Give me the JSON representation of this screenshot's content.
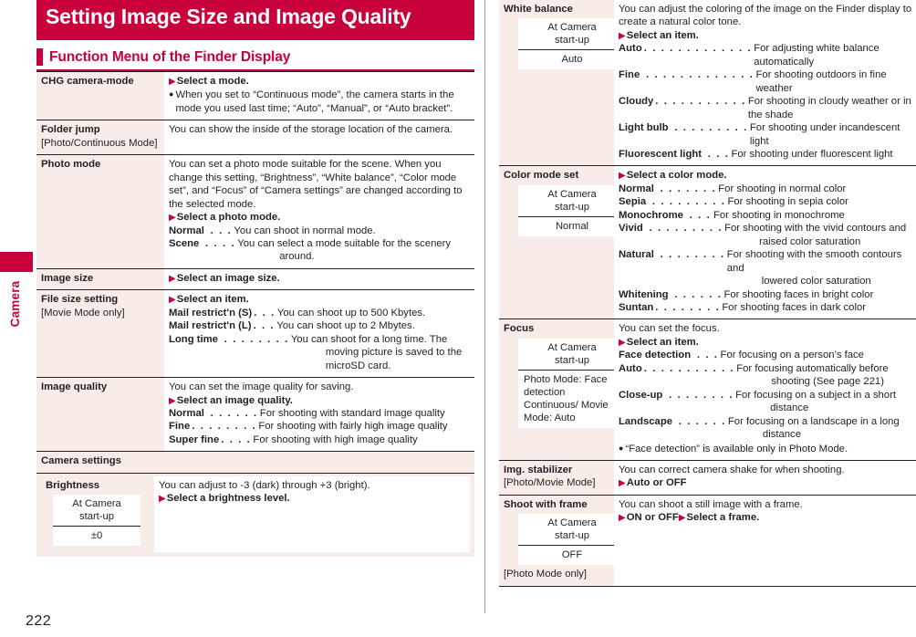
{
  "document": {
    "title": "Setting Image Size and Image Quality",
    "subhead": "Function Menu of the Finder Display",
    "page_number": "222",
    "edge_tab_label": "Camera",
    "accent_color": "#c8003c",
    "label_bg_color": "#f8ece8"
  },
  "start_up_box": {
    "header": "At Camera start-up",
    "header_line1": "At Camera",
    "header_line2": "start-up"
  },
  "left_column": {
    "rows": [
      {
        "label": "CHG camera-mode",
        "sublabel": "",
        "step": "Select a mode.",
        "bullets": [
          "When you set to “Continuous mode”, the camera starts in the mode you used last time; “Auto”, “Manual”, or “Auto bracket”."
        ],
        "intro": "",
        "defs": []
      },
      {
        "label": "Folder jump",
        "sublabel": "[Photo/Continuous Mode]",
        "step": "",
        "bullets": [],
        "intro": "You can show the inside of the storage location of the camera.",
        "defs": []
      },
      {
        "label": "Photo mode",
        "sublabel": "",
        "step": "Select a photo mode.",
        "bullets": [],
        "intro": "You can set a photo mode suitable for the scene. When you change this setting, “Brightness”, “White balance”, “Color mode set”, and “Focus” of “Camera settings” are changed according to the selected mode.",
        "defs": [
          {
            "term": "Normal",
            "def": "You can shoot in normal mode."
          },
          {
            "term": "Scene",
            "def": "You can select a mode suitable for the scenery",
            "cont": "around."
          }
        ]
      },
      {
        "label": "Image size",
        "sublabel": "",
        "step": "Select an image size.",
        "bullets": [],
        "intro": "",
        "defs": []
      },
      {
        "label": "File size setting",
        "sublabel": "[Movie Mode only]",
        "step": "Select an item.",
        "bullets": [],
        "intro": "",
        "defs": [
          {
            "term": "Mail restrict'n (S)",
            "def": "You can shoot up to 500 Kbytes."
          },
          {
            "term": "Mail restrict'n (L)",
            "def": "You can shoot up to 2 Mbytes."
          },
          {
            "term": "Long time",
            "def": "You can shoot for a long time. The",
            "cont": "moving picture is saved to the microSD card."
          }
        ]
      },
      {
        "label": "Image quality",
        "sublabel": "",
        "step": "Select an image quality.",
        "bullets": [],
        "intro": "You can set the image quality for saving.",
        "defs": [
          {
            "term": "Normal",
            "def": "For shooting with standard image quality"
          },
          {
            "term": "Fine",
            "def": "For shooting with fairly high image quality"
          },
          {
            "term": "Super fine",
            "def": "For shooting with high image quality"
          }
        ]
      }
    ],
    "section": {
      "title": "Camera settings",
      "rows": [
        {
          "label": "Brightness",
          "intro": "You can adjust to -3 (dark) through +3 (bright).",
          "step": "Select a brightness level.",
          "startup_value": "±0"
        }
      ]
    }
  },
  "right_column": {
    "rows": [
      {
        "label": "White balance",
        "sublabel": "",
        "startup_value": "Auto",
        "startup_value_multiline": "",
        "intro": "You can adjust the coloring of the image on the Finder display to create a natural color tone.",
        "step": "Select an item.",
        "defs": [
          {
            "term": "Auto",
            "def": "For adjusting white balance",
            "cont": "automatically"
          },
          {
            "term": "Fine",
            "def": "For shooting outdoors in fine weather"
          },
          {
            "term": "Cloudy",
            "def": "For shooting in cloudy weather or in",
            "cont": "the shade"
          },
          {
            "term": "Light bulb",
            "def": "For shooting under incandescent light"
          },
          {
            "term": "Fluorescent light",
            "def": "For shooting under fluorescent light"
          }
        ],
        "bullets": []
      },
      {
        "label": "Color mode set",
        "sublabel": "",
        "startup_value": "Normal",
        "startup_value_multiline": "",
        "intro": "",
        "step": "Select a color mode.",
        "defs": [
          {
            "term": "Normal",
            "def": "For shooting in normal color"
          },
          {
            "term": "Sepia",
            "def": "For shooting in sepia color"
          },
          {
            "term": "Monochrome",
            "def": "For shooting in monochrome"
          },
          {
            "term": "Vivid",
            "def": "For shooting with the vivid contours and",
            "cont": "raised color saturation"
          },
          {
            "term": "Natural",
            "def": "For shooting with the smooth contours and",
            "cont": "lowered color saturation"
          },
          {
            "term": "Whitening",
            "def": "For shooting faces in bright color"
          },
          {
            "term": "Suntan",
            "def": "For shooting faces in dark color"
          }
        ],
        "bullets": []
      },
      {
        "label": "Focus",
        "sublabel": "",
        "startup_value": "",
        "startup_value_multiline": "Photo Mode: Face detection Continuous/ Movie Mode: Auto",
        "intro": "You can set the focus.",
        "step": "Select an item.",
        "defs": [
          {
            "term": "Face detection",
            "def": "For focusing on a person’s face"
          },
          {
            "term": "Auto",
            "def": "For focusing automatically before",
            "cont": "shooting (See page 221)"
          },
          {
            "term": "Close-up",
            "def": "For focusing on a subject in a short",
            "cont": "distance"
          },
          {
            "term": "Landscape",
            "def": "For focusing on a landscape in a long",
            "cont": "distance"
          }
        ],
        "bullets": [
          "“Face detection” is available only in Photo Mode."
        ]
      },
      {
        "label": "Img. stabilizer",
        "sublabel": "[Photo/Movie Mode]",
        "startup_value": "",
        "startup_value_multiline": "",
        "intro": "You can correct camera shake for when shooting.",
        "step": "Auto or OFF",
        "defs": [],
        "bullets": []
      },
      {
        "label": "Shoot with frame",
        "sublabel": "[Photo Mode only]",
        "startup_value": "OFF",
        "startup_value_multiline": "",
        "intro": "You can shoot a still image with a frame.",
        "step": "ON or OFF",
        "step2": "Select a frame.",
        "defs": [],
        "bullets": []
      }
    ]
  }
}
